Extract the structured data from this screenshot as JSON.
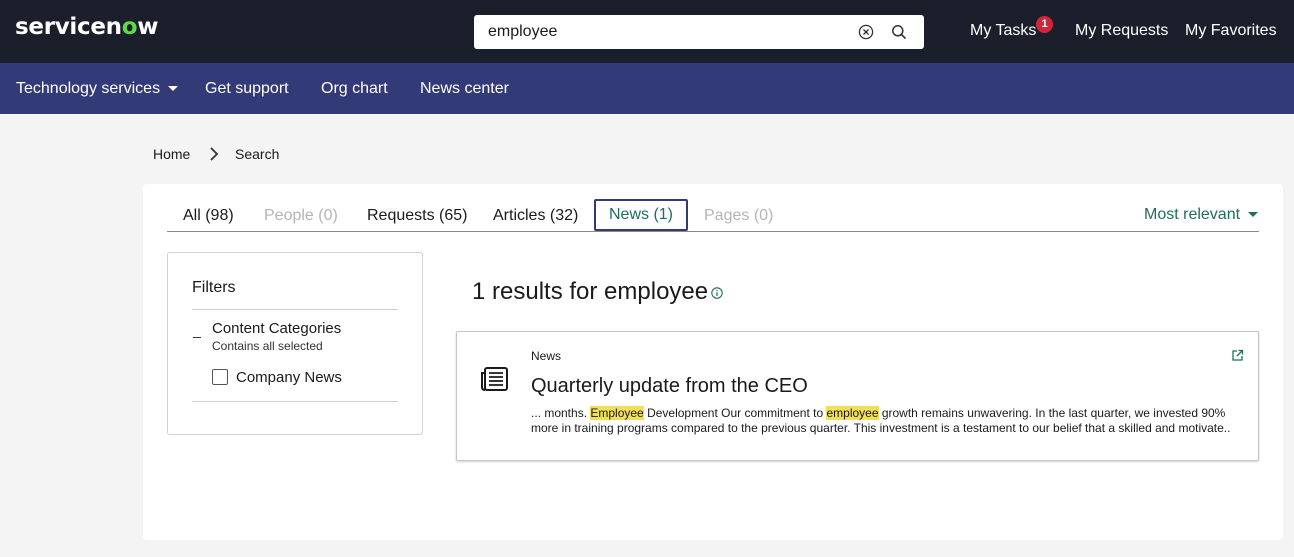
{
  "brand": {
    "logo_pre": "servicen",
    "logo_o": "o",
    "logo_post": "w",
    "accent": "#62d84e"
  },
  "header": {
    "search_value": "employee",
    "links": {
      "tasks": "My Tasks",
      "requests": "My Requests",
      "favorites": "My Favorites"
    },
    "tasks_badge": "1"
  },
  "nav": {
    "items": [
      {
        "label": "Technology services"
      },
      {
        "label": "Get support"
      },
      {
        "label": "Org chart"
      },
      {
        "label": "News center"
      }
    ]
  },
  "breadcrumb": {
    "home": "Home",
    "current": "Search"
  },
  "tabs": {
    "all": "All (98)",
    "people": "People (0)",
    "requests": "Requests (65)",
    "articles": "Articles (32)",
    "news": "News (1)",
    "pages": "Pages (0)"
  },
  "sort": {
    "label": "Most relevant"
  },
  "filters": {
    "title": "Filters",
    "toggle": "_",
    "category": "Content Categories",
    "category_note": "Contains all selected",
    "option": "Company News"
  },
  "results": {
    "heading": "1 results for employee",
    "item": {
      "type": "News",
      "title": "Quarterly update from the CEO",
      "s1": "... months. ",
      "h1": "Employee",
      "s2": " Development Our commitment to ",
      "h2": "employee",
      "s3": " growth remains unwavering. In the last quarter, we invested 90%",
      "line2": "more in training programs compared to the previous quarter. This investment is a testament to our belief that a skilled and motivate..."
    }
  },
  "colors": {
    "topbar": "#1a1f2b",
    "navbar": "#333a78",
    "badge": "#d0263a",
    "link_green": "#1f6e5a",
    "highlight": "#f1df5a"
  }
}
